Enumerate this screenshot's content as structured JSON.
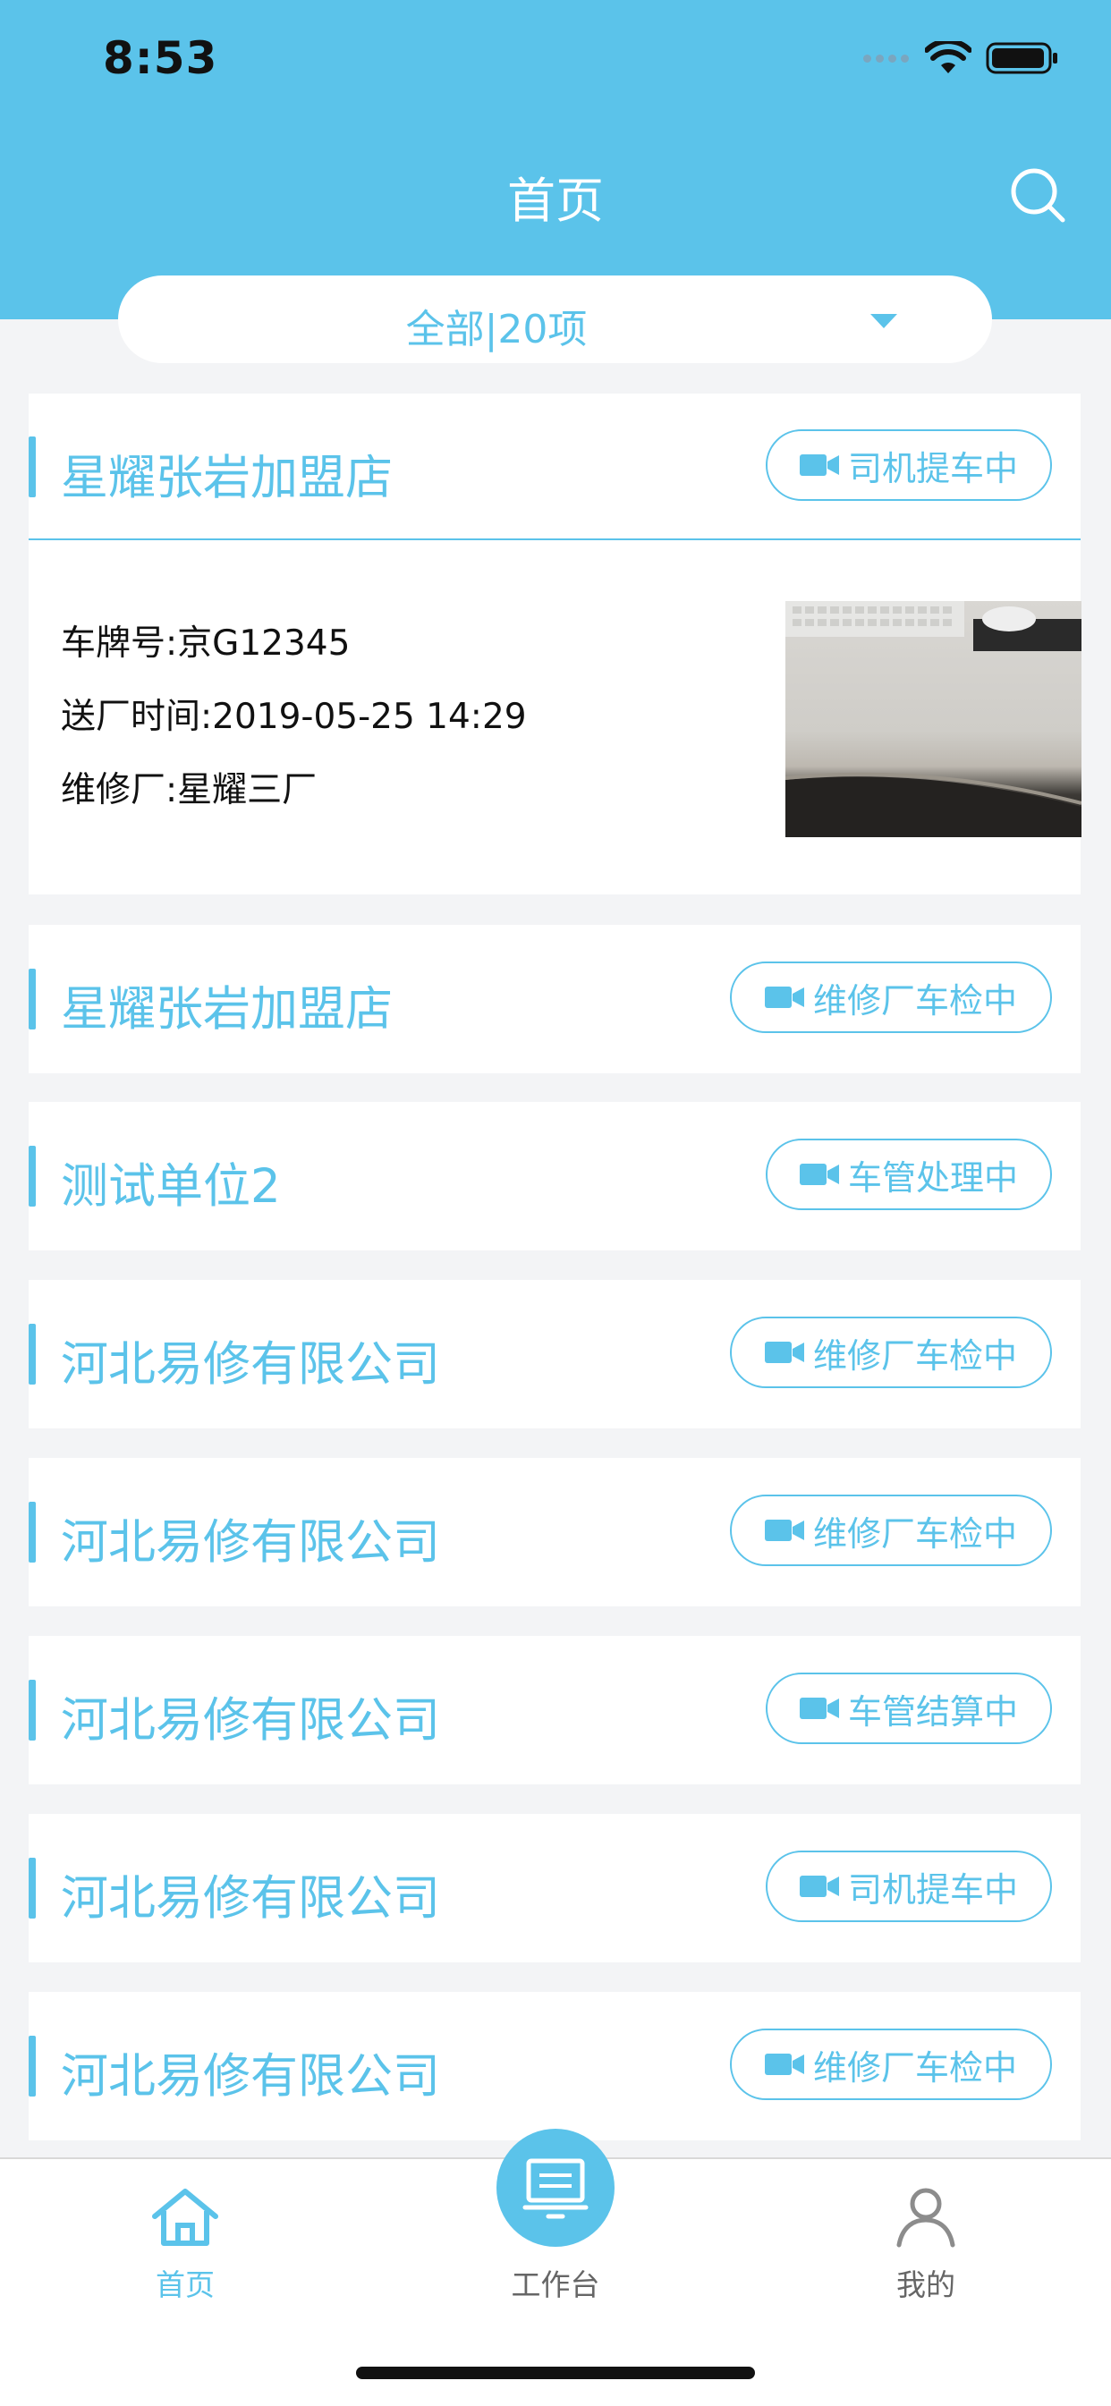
{
  "status_bar": {
    "time": "8:53"
  },
  "header": {
    "title": "首页",
    "search_icon": "search-icon"
  },
  "filter": {
    "label": "全部|20项"
  },
  "colors": {
    "accent": "#5bc3ea",
    "background": "#f3f4f6"
  },
  "first_item": {
    "company": "星耀张岩加盟店",
    "status": "司机提车中",
    "plate": "车牌号:京G12345",
    "delivery_time": "送厂时间:2019-05-25 14:29",
    "repair_shop": "维修厂:星耀三厂"
  },
  "items": [
    {
      "company": "星耀张岩加盟店",
      "status": "维修厂车检中"
    },
    {
      "company": "测试单位2",
      "status": "车管处理中"
    },
    {
      "company": "河北易修有限公司",
      "status": "维修厂车检中"
    },
    {
      "company": "河北易修有限公司",
      "status": "维修厂车检中"
    },
    {
      "company": "河北易修有限公司",
      "status": "车管结算中"
    },
    {
      "company": "河北易修有限公司",
      "status": "司机提车中"
    },
    {
      "company": "河北易修有限公司",
      "status": "维修厂车检中"
    }
  ],
  "tabbar": {
    "home": "首页",
    "workbench": "工作台",
    "mine": "我的"
  }
}
